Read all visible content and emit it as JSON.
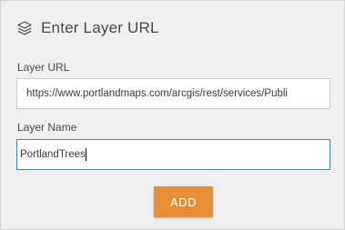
{
  "panel": {
    "title": "Enter Layer URL",
    "title_icon": "layers-icon"
  },
  "fields": {
    "url": {
      "label": "Layer URL",
      "value": "https://www.portlandmaps.com/arcgis/rest/services/Publi"
    },
    "name": {
      "label": "Layer Name",
      "value": "PortlandTrees"
    }
  },
  "actions": {
    "add_label": "ADD"
  },
  "colors": {
    "accent": "#e78f35",
    "focus_border": "#4d7fa8",
    "panel_bg": "#efefef"
  }
}
